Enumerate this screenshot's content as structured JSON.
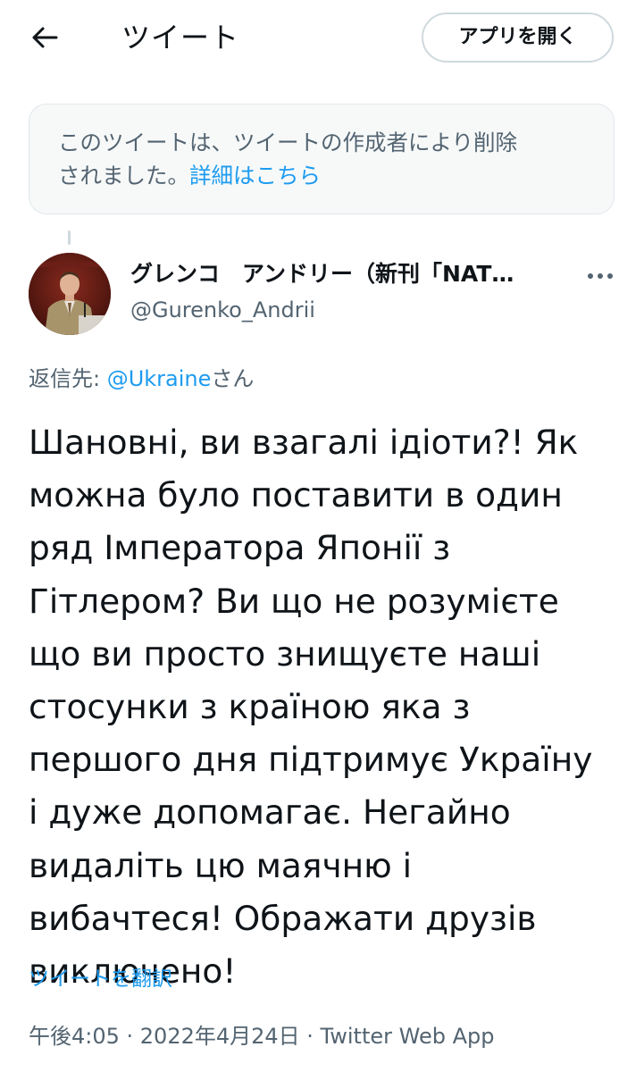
{
  "header": {
    "title": "ツイート",
    "open_app_label": "アプリを開く"
  },
  "notice": {
    "line1": "このツイートは、ツイートの作成者により削除",
    "line2_text": "されました。",
    "link_label": "詳細はこちら"
  },
  "author": {
    "name": "グレンコ　アンドリー（新刊「NAT…",
    "handle": "@Gurenko_Andrii"
  },
  "reply": {
    "prefix": "返信先: ",
    "mention": "@Ukraine",
    "suffix": "さん"
  },
  "tweet": {
    "lines": [
      "Шановні, ви взагалі ідіоти?! Як",
      "можна було поставити в один",
      "ряд Імператора Японії з",
      "Гітлером? Ви що не розумієте",
      "що ви просто знищуєте наші",
      "стосунки з країною яка з",
      "першого дня підтримує Україну",
      "і дуже допомагає. Негайно",
      "видаліть цю маячню і",
      "вибачтеся! Ображати друзів",
      "виключено!"
    ],
    "translate_label": "ツイートを翻訳",
    "meta": "午後4:05 · 2022年4月24日 · Twitter Web App"
  },
  "colors": {
    "accent": "#1d9bf0",
    "secondary_text": "#536471",
    "notice_bg": "#f7f9f9"
  },
  "icons": {
    "back": "arrow-left-icon",
    "more": "more-horizontal-icon"
  }
}
